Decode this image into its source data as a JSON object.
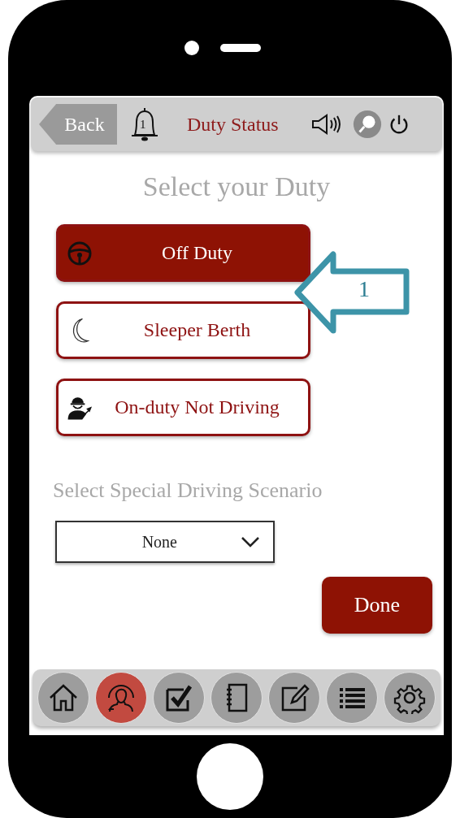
{
  "header": {
    "back": "Back",
    "notification_count": "1",
    "title": "Duty Status"
  },
  "heading": "Select your Duty",
  "duties": [
    {
      "label": "Off Duty",
      "kind": "wheel",
      "selected": true
    },
    {
      "label": "Sleeper Berth",
      "kind": "moon",
      "selected": false
    },
    {
      "label": "On-duty Not Driving",
      "kind": "worker",
      "selected": false
    }
  ],
  "scenario": {
    "label": "Select Special Driving Scenario",
    "value": "None"
  },
  "done": "Done",
  "nav": [
    {
      "kind": "home",
      "selected": false
    },
    {
      "kind": "person",
      "selected": true
    },
    {
      "kind": "check",
      "selected": false
    },
    {
      "kind": "notebook",
      "selected": false
    },
    {
      "kind": "edit",
      "selected": false
    },
    {
      "kind": "list",
      "selected": false
    },
    {
      "kind": "settings",
      "selected": false
    }
  ],
  "callout": {
    "label": "1"
  }
}
